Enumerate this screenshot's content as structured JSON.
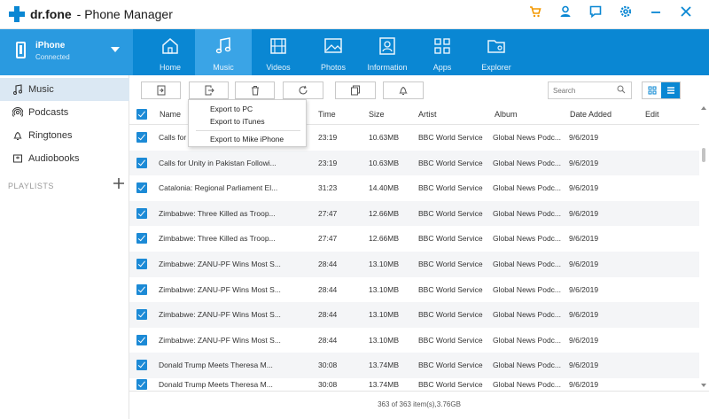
{
  "app": {
    "brand": "dr.fone",
    "title": "- Phone Manager"
  },
  "window_icons": [
    "cart-icon",
    "user-icon",
    "feedback-icon",
    "settings-icon",
    "minimize-icon",
    "close-icon"
  ],
  "device": {
    "name": "iPhone",
    "status": "Connected"
  },
  "tabs": [
    {
      "label": "Home",
      "icon": "home-icon",
      "active": false
    },
    {
      "label": "Music",
      "icon": "music-icon",
      "active": true
    },
    {
      "label": "Videos",
      "icon": "video-icon",
      "active": false
    },
    {
      "label": "Photos",
      "icon": "photo-icon",
      "active": false
    },
    {
      "label": "Information",
      "icon": "contact-icon",
      "active": false
    },
    {
      "label": "Apps",
      "icon": "apps-icon",
      "active": false
    },
    {
      "label": "Explorer",
      "icon": "folder-icon",
      "active": false
    }
  ],
  "sidebar": {
    "items": [
      {
        "label": "Music",
        "icon": "music-note-icon",
        "active": true
      },
      {
        "label": "Podcasts",
        "icon": "podcast-icon",
        "active": false
      },
      {
        "label": "Ringtones",
        "icon": "bell-icon",
        "active": false
      },
      {
        "label": "Audiobooks",
        "icon": "book-icon",
        "active": false
      }
    ],
    "playlists_label": "PLAYLISTS"
  },
  "toolbar": {
    "search_placeholder": "Search"
  },
  "export_menu": {
    "items": [
      "Export to PC",
      "Export to iTunes",
      "Export to  Mike iPhone"
    ]
  },
  "table": {
    "columns": [
      "Name",
      "Time",
      "Size",
      "Artist",
      "Album",
      "Date Added",
      "Edit"
    ],
    "rows": [
      {
        "name": "Calls for",
        "time": "23:19",
        "size": "10.63MB",
        "artist": "BBC World Service",
        "album": "Global News Podc...",
        "date": "9/6/2019"
      },
      {
        "name": "Calls for Unity in Pakistan Followi...",
        "time": "23:19",
        "size": "10.63MB",
        "artist": "BBC World Service",
        "album": "Global News Podc...",
        "date": "9/6/2019"
      },
      {
        "name": "Catalonia: Regional Parliament El...",
        "time": "31:23",
        "size": "14.40MB",
        "artist": "BBC World Service",
        "album": "Global News Podc...",
        "date": "9/6/2019"
      },
      {
        "name": "Zimbabwe: Three Killed as Troop...",
        "time": "27:47",
        "size": "12.66MB",
        "artist": "BBC World Service",
        "album": "Global News Podc...",
        "date": "9/6/2019"
      },
      {
        "name": "Zimbabwe: Three Killed as Troop...",
        "time": "27:47",
        "size": "12.66MB",
        "artist": "BBC World Service",
        "album": "Global News Podc...",
        "date": "9/6/2019"
      },
      {
        "name": "Zimbabwe: ZANU-PF Wins Most S...",
        "time": "28:44",
        "size": "13.10MB",
        "artist": "BBC World Service",
        "album": "Global News Podc...",
        "date": "9/6/2019"
      },
      {
        "name": "Zimbabwe: ZANU-PF Wins Most S...",
        "time": "28:44",
        "size": "13.10MB",
        "artist": "BBC World Service",
        "album": "Global News Podc...",
        "date": "9/6/2019"
      },
      {
        "name": "Zimbabwe: ZANU-PF Wins Most S...",
        "time": "28:44",
        "size": "13.10MB",
        "artist": "BBC World Service",
        "album": "Global News Podc...",
        "date": "9/6/2019"
      },
      {
        "name": "Zimbabwe: ZANU-PF Wins Most S...",
        "time": "28:44",
        "size": "13.10MB",
        "artist": "BBC World Service",
        "album": "Global News Podc...",
        "date": "9/6/2019"
      },
      {
        "name": "Donald Trump Meets Theresa M...",
        "time": "30:08",
        "size": "13.74MB",
        "artist": "BBC World Service",
        "album": "Global News Podc...",
        "date": "9/6/2019"
      },
      {
        "name": "Donald Trump Meets Theresa M...",
        "time": "30:08",
        "size": "13.74MB",
        "artist": "BBC World Service",
        "album": "Global News Podc...",
        "date": "9/6/2019"
      }
    ]
  },
  "footer": {
    "summary": "363 of 363 item(s),3.76GB"
  },
  "colors": {
    "accent": "#0a87d3",
    "active_tab": "#3aa4e6",
    "cart": "#f39800",
    "checkbox": "#1c8ad6"
  }
}
